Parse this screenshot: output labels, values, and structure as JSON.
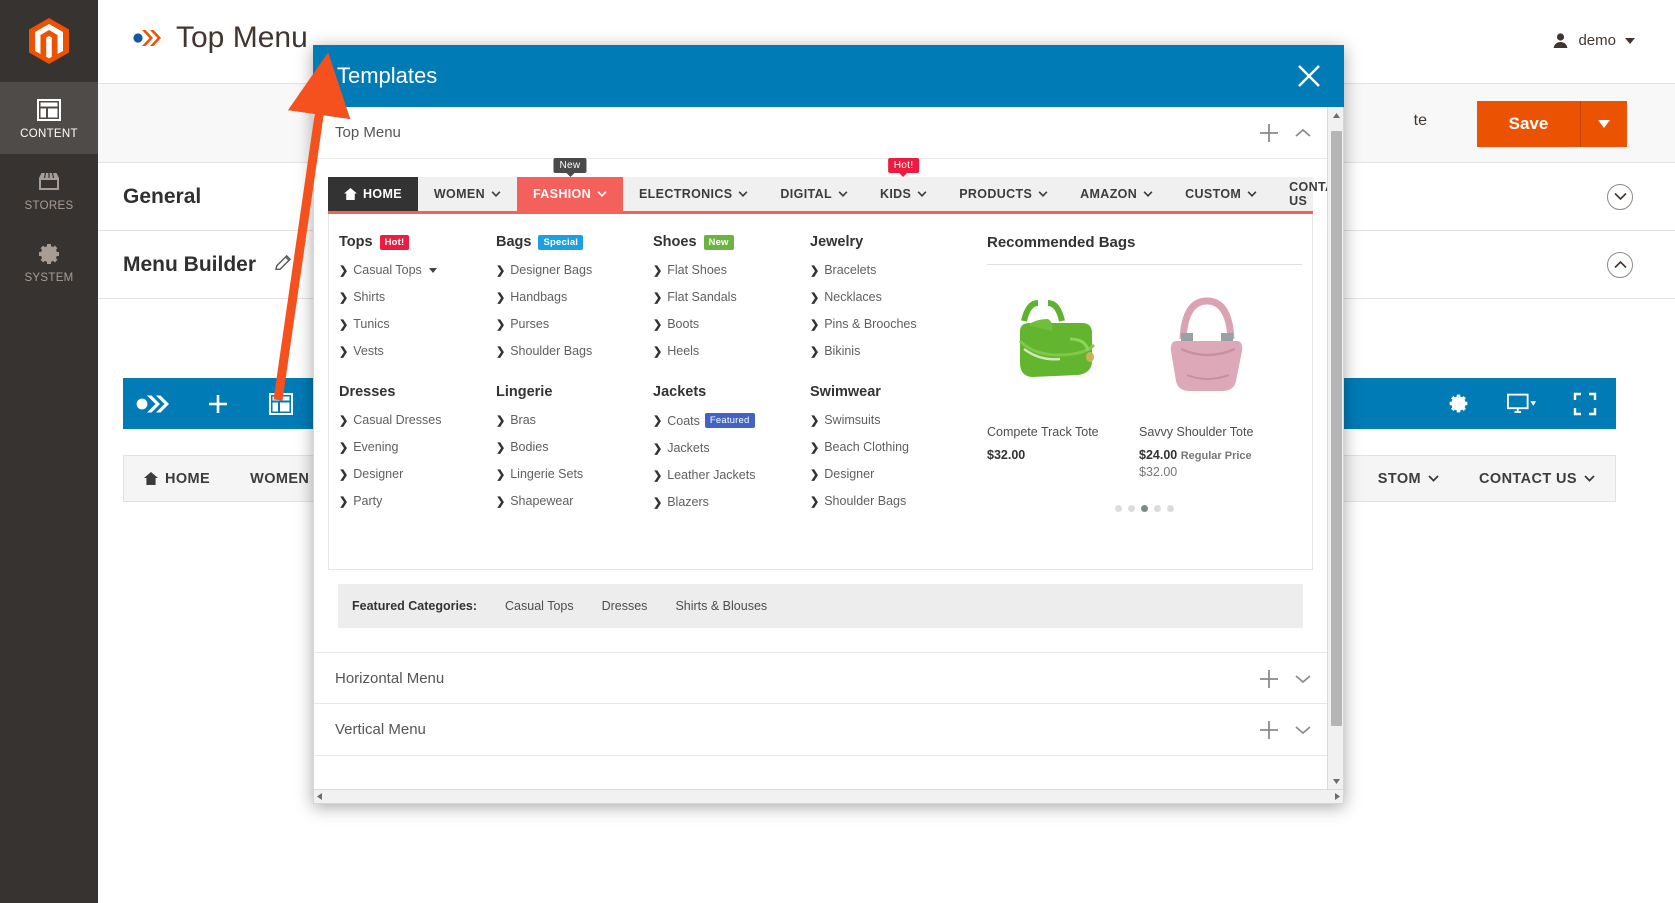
{
  "admin": {
    "rail": [
      {
        "id": "magento-logo",
        "label": "",
        "icon": "magento-logo-icon",
        "active": false
      },
      {
        "id": "content",
        "label": "CONTENT",
        "icon": "content-layout-icon",
        "active": true
      },
      {
        "id": "stores",
        "label": "STORES",
        "icon": "store-icon",
        "active": false
      },
      {
        "id": "system",
        "label": "SYSTEM",
        "icon": "gear-icon",
        "active": false
      }
    ],
    "page_title": "Top Menu",
    "user_name": "demo",
    "action_bar": {
      "delete_label": "te",
      "save_label": "Save"
    },
    "sections": [
      {
        "title": "General",
        "state": "collapsed"
      },
      {
        "title": "Menu Builder",
        "state": "expanded",
        "has_edit": true
      }
    ],
    "builder_toolbar": {
      "items": [
        "chevrons-icon",
        "plus-icon",
        "template-icon"
      ],
      "right_items": [
        "settings-gear-icon",
        "device-preview-icon",
        "fullscreen-icon"
      ]
    },
    "front_nav": {
      "left": [
        {
          "label": "HOME",
          "icon": "home-icon",
          "caret": false
        },
        {
          "label": "WOMEN",
          "caret": true
        }
      ],
      "right": [
        {
          "label": "STOM",
          "caret": true
        },
        {
          "label": "CONTACT US",
          "caret": true
        }
      ]
    }
  },
  "modal": {
    "title": "Templates",
    "close_icon": "close-icon",
    "accordions": [
      {
        "title": "Top Menu",
        "expanded": true,
        "add_icon": "plus-icon",
        "toggle_icon": "chevron-up-icon"
      },
      {
        "title": "Horizontal Menu",
        "expanded": false,
        "add_icon": "plus-icon",
        "toggle_icon": "chevron-down-icon"
      },
      {
        "title": "Vertical Menu",
        "expanded": false,
        "add_icon": "plus-icon",
        "toggle_icon": "chevron-down-icon"
      }
    ],
    "preview": {
      "nav_left": [
        {
          "label": "HOME",
          "icon": "home-icon",
          "caret": false,
          "style": "home",
          "badge": null
        },
        {
          "label": "WOMEN",
          "caret": true,
          "style": "normal",
          "badge": null
        },
        {
          "label": "FASHION",
          "caret": true,
          "style": "active",
          "badge": {
            "text": "New",
            "type": "new"
          }
        },
        {
          "label": "ELECTRONICS",
          "caret": true,
          "style": "normal",
          "badge": null
        },
        {
          "label": "DIGITAL",
          "caret": true,
          "style": "normal",
          "badge": null
        },
        {
          "label": "KIDS",
          "caret": true,
          "style": "normal",
          "badge": {
            "text": "Hot!",
            "type": "hot"
          }
        },
        {
          "label": "PRODUCTS",
          "caret": true,
          "style": "normal",
          "badge": null
        },
        {
          "label": "AMAZON",
          "caret": true,
          "style": "normal",
          "badge": null
        }
      ],
      "nav_right": [
        {
          "label": "CUSTOM",
          "caret": true,
          "style": "normal",
          "badge": null
        },
        {
          "label": "CONTACT US",
          "caret": true,
          "style": "normal",
          "badge": null
        }
      ],
      "columns": [
        {
          "groups": [
            {
              "title": "Tops",
              "tag": {
                "text": "Hot!",
                "color": "#ec1c40"
              },
              "links": [
                {
                  "label": "Casual Tops",
                  "has_caret": true
                },
                {
                  "label": "Shirts"
                },
                {
                  "label": "Tunics"
                },
                {
                  "label": "Vests"
                }
              ]
            },
            {
              "title": "Dresses",
              "tag": null,
              "links": [
                {
                  "label": "Casual Dresses"
                },
                {
                  "label": "Evening"
                },
                {
                  "label": "Designer"
                },
                {
                  "label": "Party"
                }
              ]
            }
          ]
        },
        {
          "groups": [
            {
              "title": "Bags",
              "tag": {
                "text": "Special",
                "color": "#1ba0e2"
              },
              "links": [
                {
                  "label": "Designer Bags"
                },
                {
                  "label": "Handbags"
                },
                {
                  "label": "Purses"
                },
                {
                  "label": "Shoulder Bags"
                }
              ]
            },
            {
              "title": "Lingerie",
              "tag": null,
              "links": [
                {
                  "label": "Bras"
                },
                {
                  "label": "Bodies"
                },
                {
                  "label": "Lingerie Sets"
                },
                {
                  "label": "Shapewear"
                }
              ]
            }
          ]
        },
        {
          "groups": [
            {
              "title": "Shoes",
              "tag": {
                "text": "New",
                "color": "#6cb33f"
              },
              "links": [
                {
                  "label": "Flat Shoes"
                },
                {
                  "label": "Flat Sandals"
                },
                {
                  "label": "Boots"
                },
                {
                  "label": "Heels"
                }
              ]
            },
            {
              "title": "Jackets",
              "tag": null,
              "links": [
                {
                  "label": "Coats",
                  "tag": {
                    "text": "Featured",
                    "color": "#4262c4"
                  }
                },
                {
                  "label": "Jackets"
                },
                {
                  "label": "Leather Jackets"
                },
                {
                  "label": "Blazers"
                }
              ]
            }
          ]
        },
        {
          "groups": [
            {
              "title": "Jewelry",
              "tag": null,
              "links": [
                {
                  "label": "Bracelets"
                },
                {
                  "label": "Necklaces"
                },
                {
                  "label": "Pins & Brooches"
                },
                {
                  "label": "Bikinis"
                }
              ]
            },
            {
              "title": "Swimwear",
              "tag": null,
              "links": [
                {
                  "label": "Swimsuits"
                },
                {
                  "label": "Beach Clothing"
                },
                {
                  "label": "Designer"
                },
                {
                  "label": "Shoulder Bags"
                }
              ]
            }
          ]
        }
      ],
      "recommended": {
        "title": "Recommended Bags",
        "products": [
          {
            "name": "Compete Track Tote",
            "price": "$32.00",
            "regular_label": null,
            "old_price": null,
            "image": "green-duffel-bag"
          },
          {
            "name": "Savvy Shoulder Tote",
            "price": "$24.00",
            "regular_label": "Regular Price",
            "old_price": "$32.00",
            "image": "pink-shoulder-bag"
          }
        ],
        "carousel_dots": 5,
        "active_dot": 3
      },
      "featured": {
        "label": "Featured Categories:",
        "items": [
          "Casual Tops",
          "Dresses",
          "Shirts & Blouses"
        ]
      }
    }
  },
  "colors": {
    "accent_blue": "#007bb6",
    "magento_orange": "#eb5202",
    "annotation_orange": "#f4511e",
    "nav_active_red": "#f4605b",
    "rail_dark": "#373330"
  }
}
